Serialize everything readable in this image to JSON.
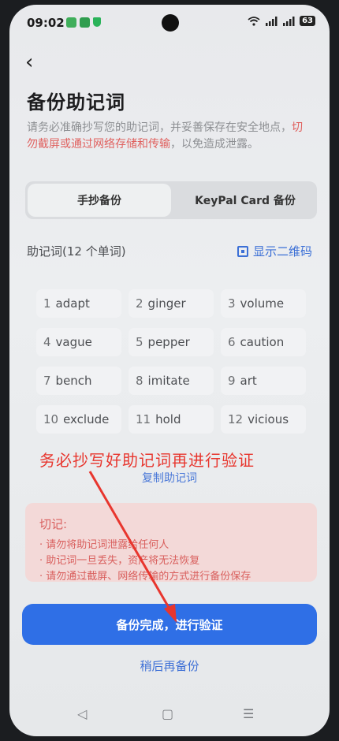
{
  "status": {
    "time": "09:02",
    "battery": "63",
    "signal": "⁶ᴳ",
    "wifi_icon": "wifi-icon"
  },
  "header": {
    "back_icon": "‹",
    "title": "备份助记词",
    "desc_prefix": "请务必准确抄写您的助记词，并妥善保存在安全地点，",
    "desc_warning": "切勿截屏或通过网络存储和传输",
    "desc_suffix": "，以免造成泄露。"
  },
  "tabs": [
    {
      "label": "手抄备份",
      "active": true
    },
    {
      "label": "KeyPal Card 备份",
      "active": false
    }
  ],
  "words_section": {
    "label": "助记词(12 个单词)",
    "qr_label": "显示二维码"
  },
  "words": [
    {
      "num": "1",
      "word": "adapt"
    },
    {
      "num": "2",
      "word": "ginger"
    },
    {
      "num": "3",
      "word": "volume"
    },
    {
      "num": "4",
      "word": "vague"
    },
    {
      "num": "5",
      "word": "pepper"
    },
    {
      "num": "6",
      "word": "caution"
    },
    {
      "num": "7",
      "word": "bench"
    },
    {
      "num": "8",
      "word": "imitate"
    },
    {
      "num": "9",
      "word": "art"
    },
    {
      "num": "10",
      "word": "exclude"
    },
    {
      "num": "11",
      "word": "hold"
    },
    {
      "num": "12",
      "word": "vicious"
    }
  ],
  "overlay_text": "务必抄写好助记词再进行验证",
  "copy_label": "复制助记词",
  "notice": {
    "title": "切记:",
    "items": [
      "请勿将助记词泄露给任何人",
      "助记词一旦丢失，资产将无法恢复",
      "请勿通过截屏、网络传输的方式进行备份保存"
    ]
  },
  "buttons": {
    "primary": "备份完成，进行验证",
    "later": "稍后再备份"
  },
  "nav": {
    "back": "◁",
    "home": "▢",
    "menu": "☰"
  },
  "colors": {
    "primary": "#2f6fe6",
    "warning": "#e0615f",
    "overlay_red": "#e8362e",
    "link": "#3b6fd6"
  }
}
